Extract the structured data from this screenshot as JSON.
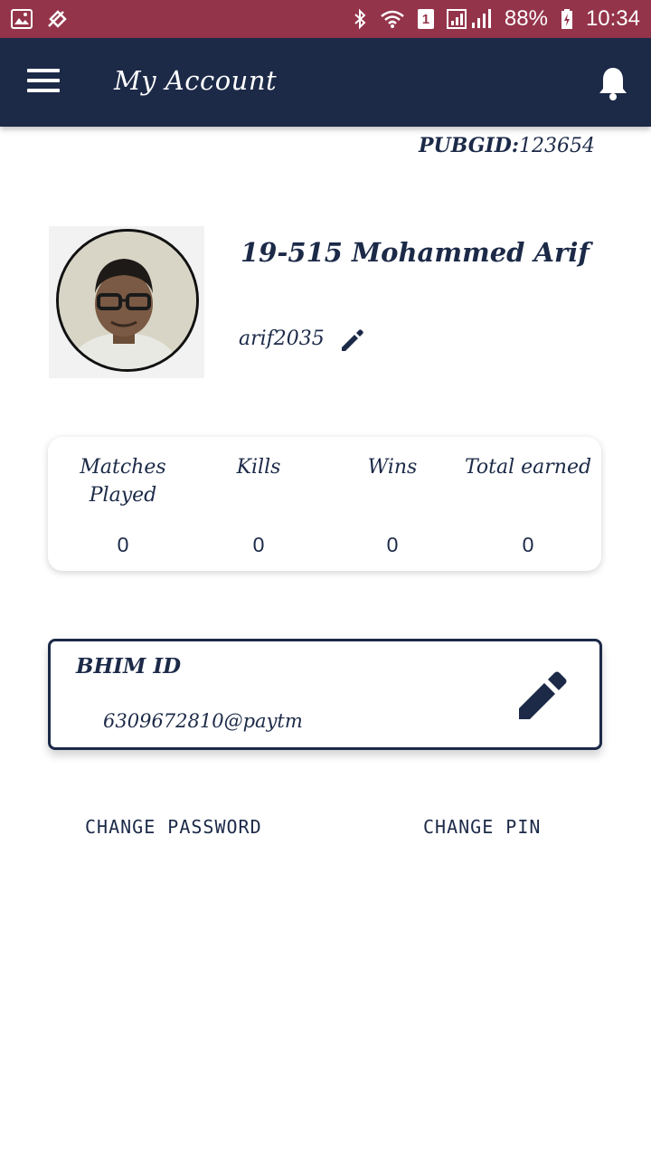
{
  "status_bar": {
    "sim_badge": "1",
    "battery": "88%",
    "time": "10:34"
  },
  "app_bar": {
    "title": "My Account",
    "menu_icon": "hamburger-menu-icon",
    "notification_icon": "bell-icon"
  },
  "pubg": {
    "label": "PUBGID:",
    "value": "123654"
  },
  "profile": {
    "name": "19-515 Mohammed Arif",
    "username": "arif2035",
    "edit_icon": "pencil-icon"
  },
  "stats": [
    {
      "label": "Matches Played",
      "value": "0"
    },
    {
      "label": "Kills",
      "value": "0"
    },
    {
      "label": "Wins",
      "value": "0"
    },
    {
      "label": "Total earned",
      "value": "0"
    }
  ],
  "bhim": {
    "label": "BHIM ID",
    "value": "6309672810@paytm",
    "edit_icon": "pencil-icon"
  },
  "actions": {
    "change_password": "CHANGE PASSWORD",
    "change_pin": "CHANGE PIN"
  },
  "colors": {
    "status_bar": "#94344a",
    "app_bar": "#1c2a48",
    "text": "#1c2a48"
  }
}
